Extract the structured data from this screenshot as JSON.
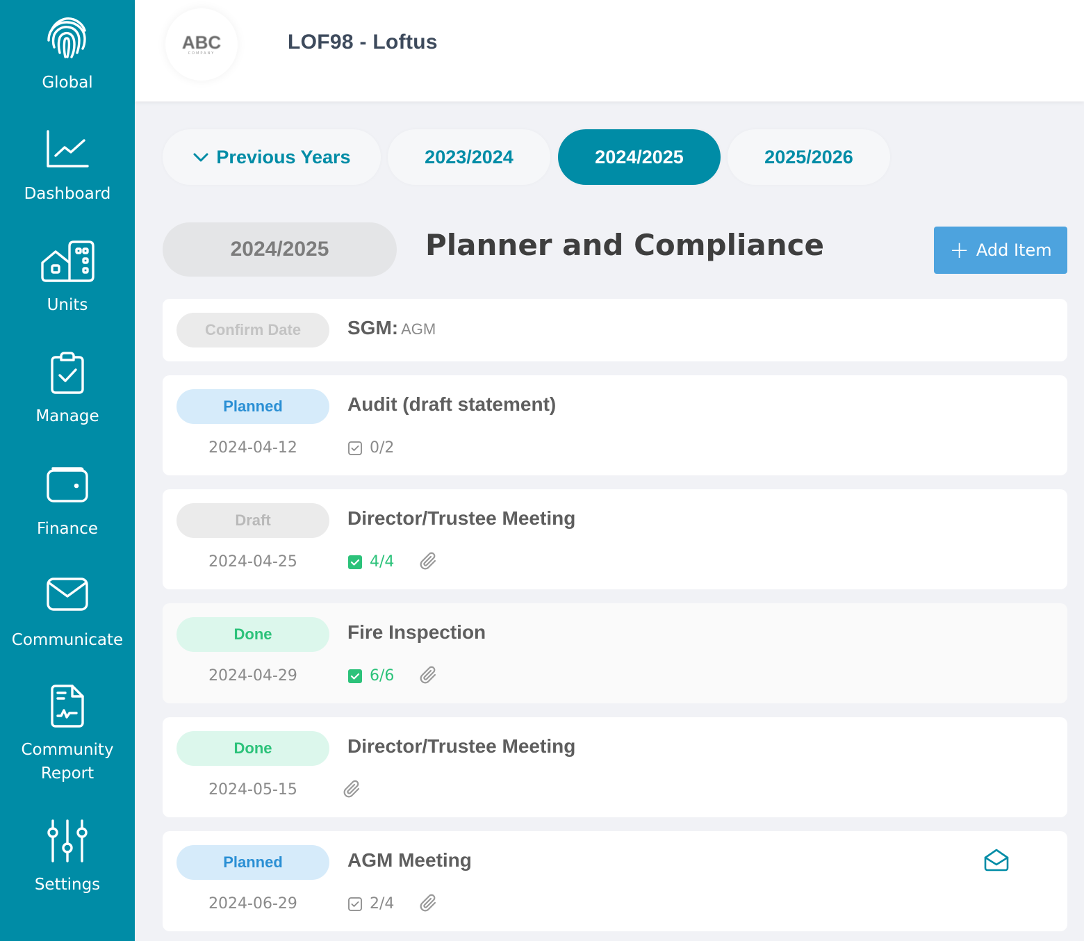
{
  "sidebar": {
    "items": [
      {
        "label": "Global",
        "icon": "fingerprint-icon"
      },
      {
        "label": "Dashboard",
        "icon": "line-chart-icon"
      },
      {
        "label": "Units",
        "icon": "buildings-icon"
      },
      {
        "label": "Manage",
        "icon": "clipboard-check-icon"
      },
      {
        "label": "Finance",
        "icon": "wallet-icon"
      },
      {
        "label": "Communicate",
        "icon": "envelope-icon"
      },
      {
        "label": "Community Report",
        "icon": "document-chart-icon"
      },
      {
        "label": "Settings",
        "icon": "sliders-icon"
      }
    ],
    "colors": {
      "background": "#008ca6",
      "text": "#ffffff"
    }
  },
  "header": {
    "logo_text": "ABC",
    "logo_sub": "COMPANY",
    "title": "LOF98 - Loftus"
  },
  "year_tabs": {
    "previous": "Previous Years",
    "tabs": [
      "2023/2024",
      "2024/2025",
      "2025/2026"
    ],
    "active": "2024/2025"
  },
  "section": {
    "year": "2024/2025",
    "title": "Planner and Compliance",
    "add_button": "Add Item"
  },
  "items": [
    {
      "status": "Confirm Date",
      "title": "SGM:",
      "subtitle": "AGM",
      "date": "",
      "tasks": "",
      "attachment": false
    },
    {
      "status": "Planned",
      "title": "Audit (draft statement)",
      "date": "2024-04-12",
      "tasks": "0/2",
      "tasks_complete": false,
      "attachment": false
    },
    {
      "status": "Draft",
      "title": "Director/Trustee Meeting",
      "date": "2024-04-25",
      "tasks": "4/4",
      "tasks_complete": true,
      "attachment": true
    },
    {
      "status": "Done",
      "title": "Fire Inspection",
      "date": "2024-04-29",
      "tasks": "6/6",
      "tasks_complete": true,
      "attachment": true
    },
    {
      "status": "Done",
      "title": "Director/Trustee Meeting",
      "date": "2024-05-15",
      "tasks": "",
      "attachment": true
    },
    {
      "status": "Planned",
      "title": "AGM Meeting",
      "date": "2024-06-29",
      "tasks": "2/4",
      "tasks_complete": false,
      "attachment": true,
      "notice_icon": "envelope-open-icon"
    }
  ],
  "colors": {
    "primary": "#008ca6",
    "add_button": "#4da3de",
    "planned": "#2a8fd4",
    "done": "#2cc27a"
  }
}
